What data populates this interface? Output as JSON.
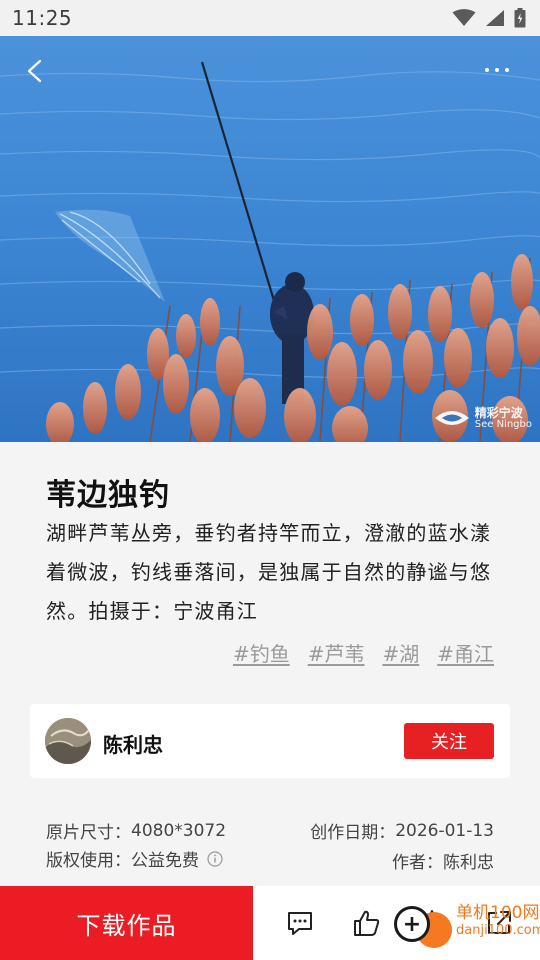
{
  "status_bar": {
    "time": "11:25"
  },
  "photo": {
    "watermark_cn": "精彩宁波",
    "watermark_en": "See Ningbo"
  },
  "post": {
    "title": "苇边独钓",
    "description": "湖畔芦苇丛旁，垂钓者持竿而立，澄澈的蓝水漾着微波，钓线垂落间，是独属于自然的静谧与悠然。拍摄于：宁波甬江",
    "tags": [
      "#钓鱼",
      "#芦苇",
      "#湖",
      "#甬江"
    ]
  },
  "author": {
    "name": "陈利忠",
    "follow_label": "关注"
  },
  "meta": {
    "size_label": "原片尺寸：",
    "size_value": "4080*3072",
    "copyright_label": "版权使用：",
    "copyright_value": "公益免费",
    "date_label": "创作日期：",
    "date_value": "2026-01-13",
    "author_label": "作者：",
    "author_value": "陈利忠"
  },
  "bottom_bar": {
    "download_label": "下载作品"
  },
  "site_watermark": {
    "name": "单机100网",
    "domain": "danji100.com"
  },
  "colors": {
    "accent_red": "#e62023",
    "water_blue": "#3c86d4",
    "reed_orange": "#d9805e"
  },
  "icons": [
    "back-arrow-icon",
    "more-icon",
    "wifi-icon",
    "signal-icon",
    "battery-icon",
    "info-icon",
    "comment-icon",
    "thumbs-up-icon",
    "star-icon",
    "share-icon"
  ]
}
